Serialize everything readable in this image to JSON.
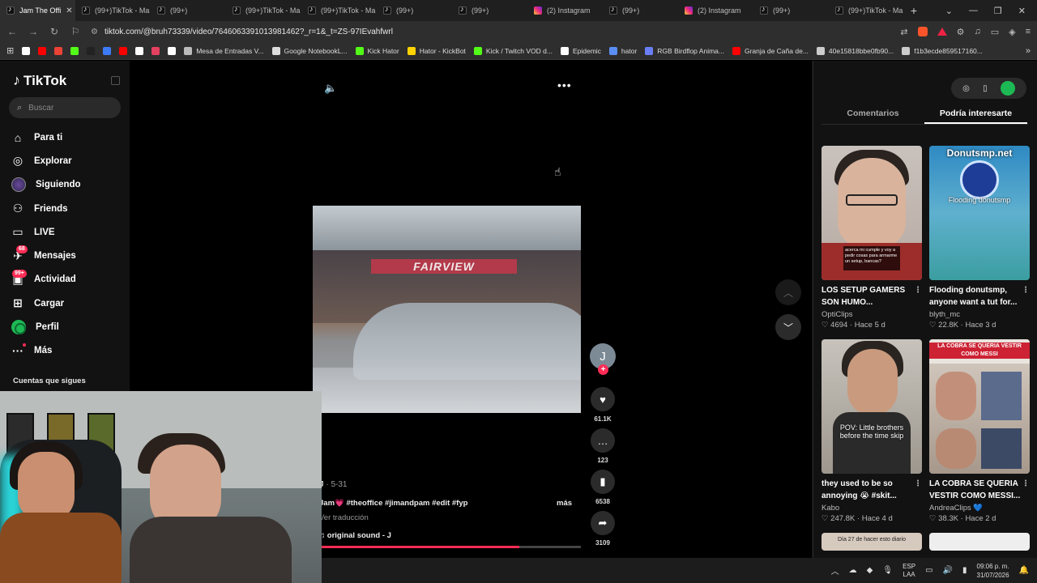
{
  "browser": {
    "tabs": [
      {
        "label": "Jam The Offi",
        "icon": "tiktok-icon",
        "active": true
      },
      {
        "label": "(99+)TikTok - Ma",
        "icon": "tiktok-icon"
      },
      {
        "label": "(99+)",
        "icon": "tiktok-icon"
      },
      {
        "label": "(99+)TikTok - Ma",
        "icon": "tiktok-icon"
      },
      {
        "label": "(99+)TikTok - Ma",
        "icon": "tiktok-icon"
      },
      {
        "label": "(99+)",
        "icon": "tiktok-icon"
      },
      {
        "label": "(99+)",
        "icon": "tiktok-icon"
      },
      {
        "label": "(2) Instagram",
        "icon": "instagram-icon"
      },
      {
        "label": "(99+)",
        "icon": "tiktok-icon"
      },
      {
        "label": "(2) Instagram",
        "icon": "instagram-icon"
      },
      {
        "label": "(99+)",
        "icon": "tiktok-icon"
      },
      {
        "label": "(99+)TikTok - Ma",
        "icon": "tiktok-icon"
      }
    ],
    "url": "tiktok.com/@bruh73339/video/7646063391013981462?_r=1&_t=ZS-97IEvahfwrl",
    "bookmarks": [
      {
        "label": "",
        "color": "#ffffff"
      },
      {
        "label": "",
        "color": "#ff0000"
      },
      {
        "label": "",
        "color": "#ea4335"
      },
      {
        "label": "",
        "color": "#53fc18"
      },
      {
        "label": "",
        "color": "#222222"
      },
      {
        "label": "",
        "color": "#3d7bf5"
      },
      {
        "label": "",
        "color": "#ff0000"
      },
      {
        "label": "",
        "color": "#ffffff"
      },
      {
        "label": "",
        "color": "#e4405f"
      },
      {
        "label": "",
        "color": "#ffffff"
      },
      {
        "label": "Mesa de Entradas V...",
        "color": "#bbbbbb"
      },
      {
        "label": "Google NotebookL...",
        "color": "#dddddd"
      },
      {
        "label": "Kick Hator",
        "color": "#53fc18"
      },
      {
        "label": "Hator - KickBot",
        "color": "#ffd400"
      },
      {
        "label": "Kick / Twitch VOD d...",
        "color": "#53fc18"
      },
      {
        "label": "Epidemic",
        "color": "#ffffff"
      },
      {
        "label": "hator",
        "color": "#5a8ef5"
      },
      {
        "label": "RGB Birdflop Anima...",
        "color": "#6a7ff5"
      },
      {
        "label": "Granja de Caña de...",
        "color": "#ff0000"
      },
      {
        "label": "40e15818bbe0fb90...",
        "color": "#cccccc"
      },
      {
        "label": "f1b3ecde859517160...",
        "color": "#cccccc"
      }
    ]
  },
  "sidebar": {
    "logo": "TikTok",
    "search_placeholder": "Buscar",
    "items": [
      {
        "label": "Para ti",
        "icon": "home-icon"
      },
      {
        "label": "Explorar",
        "icon": "compass-icon"
      },
      {
        "label": "Siguiendo",
        "icon": "avatar-icon"
      },
      {
        "label": "Friends",
        "icon": "friends-icon"
      },
      {
        "label": "LIVE",
        "icon": "live-icon"
      },
      {
        "label": "Mensajes",
        "icon": "messages-icon",
        "badge": "68"
      },
      {
        "label": "Actividad",
        "icon": "activity-icon",
        "badge": "99+"
      },
      {
        "label": "Cargar",
        "icon": "upload-icon"
      },
      {
        "label": "Perfil",
        "icon": "profile-avatar-icon"
      },
      {
        "label": "Más",
        "icon": "more-icon"
      }
    ],
    "following_title": "Cuentas que sigues"
  },
  "video": {
    "sign_text": "FAIRVIEW",
    "creator_initial": "J",
    "likes": "61.1K",
    "comments": "123",
    "saves": "6538",
    "shares": "3109",
    "author": "J",
    "date": "5-31",
    "description": "Jam💗 #theoffice #jimandpam #edit #fyp",
    "more": "más",
    "translate": "Ver traducción",
    "sound": "original sound - J",
    "progress": 0.77
  },
  "right_panel": {
    "tabs": [
      "Comentarios",
      "Podría interesarte"
    ],
    "active_tab": 1,
    "cards": [
      {
        "title": "LOS SETUP GAMERS SON HUMO...",
        "author": "OptiClips",
        "likes": "4694",
        "age": "Hace 5 d",
        "caption": "acerca mi cumple y voy a pedir cosas para armarme un setup, bancas?"
      },
      {
        "title": "Flooding donutsmp, anyone want a tut for...",
        "author": "blyth_mc",
        "likes": "22.8K",
        "age": "Hace 3 d",
        "overlay_title": "Donutsmp.net",
        "caption": "Flooding donutsmp"
      },
      {
        "title": "they used to be so annoying 😭 #skit...",
        "author": "Kabo",
        "likes": "247.8K",
        "age": "Hace 4 d",
        "caption": "POV: Little brothers before the time skip"
      },
      {
        "title": "LA COBRA SE QUERIA VESTIR COMO MESSI...",
        "author": "AndreaClips 💙",
        "likes": "38.3K",
        "age": "Hace 2 d",
        "caption": "LA COBRA SE QUERIA VESTIR COMO MESSI"
      },
      {
        "caption": "Día 27 de hacer esto diario"
      }
    ]
  },
  "taskbar": {
    "lang_top": "ESP",
    "lang_bottom": "LAA",
    "time": "09:06 p. m.",
    "date": "31/07/2026"
  },
  "colors": {
    "accent": "#fe2c55",
    "background": "#121212"
  }
}
